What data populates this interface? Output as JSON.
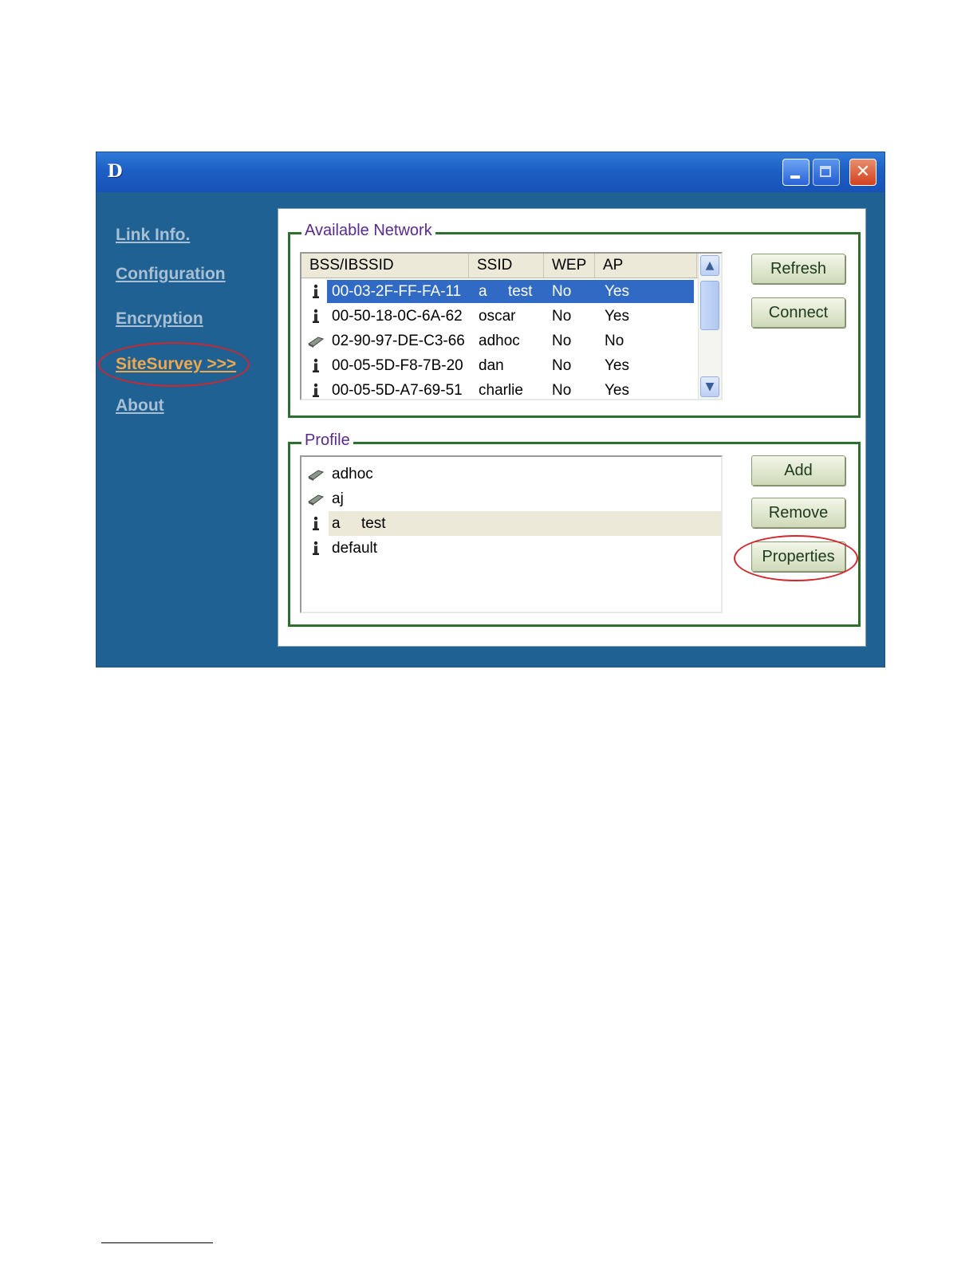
{
  "window": {
    "logo": "D"
  },
  "sidebar": {
    "items": [
      {
        "label": "Link Info."
      },
      {
        "label": "Configuration"
      },
      {
        "label": "Encryption"
      },
      {
        "label": "SiteSurvey >>>"
      },
      {
        "label": "About"
      }
    ]
  },
  "available_network": {
    "title": "Available Network",
    "columns": [
      "BSS/IBSSID",
      "SSID",
      "WEP",
      "AP"
    ],
    "rows": [
      {
        "icon": "infrastructure-icon",
        "bssid": "00-03-2F-FF-FA-11",
        "ssid": "a     test",
        "wep": "No",
        "ap": "Yes"
      },
      {
        "icon": "infrastructure-icon",
        "bssid": "00-50-18-0C-6A-62",
        "ssid": "oscar",
        "wep": "No",
        "ap": "Yes"
      },
      {
        "icon": "adhoc-icon",
        "bssid": "02-90-97-DE-C3-66",
        "ssid": "adhoc",
        "wep": "No",
        "ap": "No"
      },
      {
        "icon": "infrastructure-icon",
        "bssid": "00-05-5D-F8-7B-20",
        "ssid": "dan",
        "wep": "No",
        "ap": "Yes"
      },
      {
        "icon": "infrastructure-icon",
        "bssid": "00-05-5D-A7-69-51",
        "ssid": "charlie",
        "wep": "No",
        "ap": "Yes"
      }
    ],
    "buttons": {
      "refresh": "Refresh",
      "connect": "Connect"
    }
  },
  "profile": {
    "title": "Profile",
    "items": [
      {
        "icon": "adhoc-icon",
        "name": "adhoc"
      },
      {
        "icon": "adhoc-icon",
        "name": "aj"
      },
      {
        "icon": "infrastructure-icon",
        "name": "a     test"
      },
      {
        "icon": "infrastructure-icon",
        "name": "default"
      }
    ],
    "buttons": {
      "add": "Add",
      "remove": "Remove",
      "properties": "Properties"
    }
  },
  "colors": {
    "window_bg": "#1f6192",
    "sidebar_link": "#a9bfd3",
    "sidebar_active": "#f2a84a",
    "selection": "#316ac5",
    "group_border": "#2e6f2e",
    "group_title": "#5a2a8c",
    "annotation": "#d4252b"
  }
}
